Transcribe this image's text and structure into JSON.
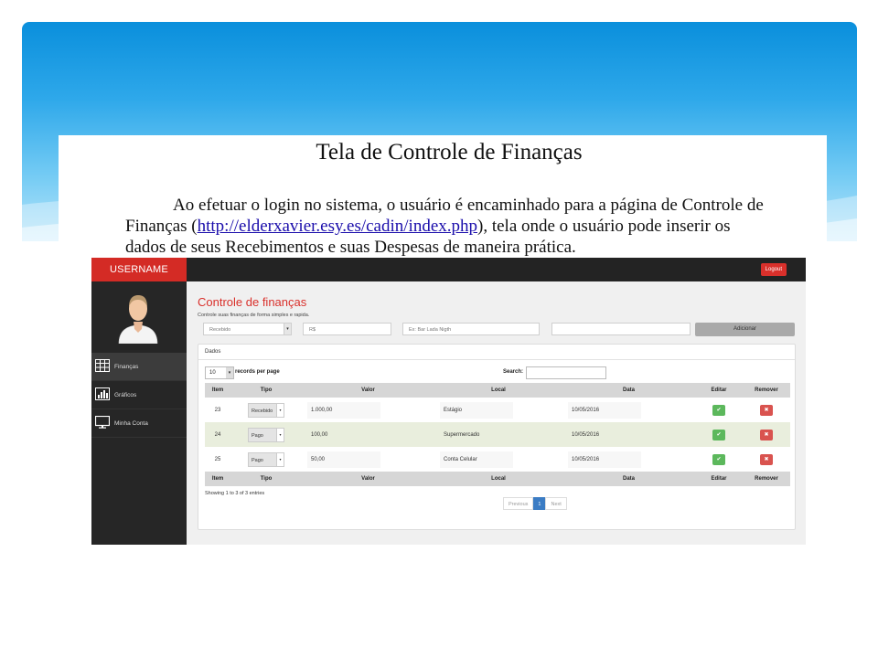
{
  "slide": {
    "title": "Tela de Controle de Finanças",
    "paragraph_before": "Ao efetuar o login no sistema, o usuário é encaminhado para a página de Controle de Finanças (",
    "link": "http://elderxavier.esy.es/cadin/index.php",
    "paragraph_after": "), tela onde o usuário pode inserir os dados de seus Recebimentos e suas Despesas de maneira prática."
  },
  "app": {
    "brand": "USERNAME",
    "logout": "Logout",
    "sidebar": [
      {
        "label": "Finanças",
        "icon": "table-icon",
        "active": true
      },
      {
        "label": "Gráficos",
        "icon": "bar-chart-icon",
        "active": false
      },
      {
        "label": "Minha Conta",
        "icon": "monitor-icon",
        "active": false
      }
    ],
    "page_title": "Controle de finanças",
    "page_subtitle": "Controle suas finanças de forma simples e rapida.",
    "form": {
      "tipo_value": "Recebido",
      "valor_placeholder": "R$",
      "local_placeholder": "Ex: Bar Lada Nigth",
      "data_value": "",
      "add_label": "Adicionar"
    },
    "panel_title": "Dados",
    "length_value": "10",
    "length_label": "records per page",
    "search_label": "Search:",
    "columns": [
      "Item",
      "Tipo",
      "Valor",
      "Local",
      "Data",
      "Editar",
      "Remover"
    ],
    "rows": [
      {
        "item": "23",
        "tipo": "Recebido",
        "valor": "1.000,00",
        "local": "Estágio",
        "data": "10/05/2016"
      },
      {
        "item": "24",
        "tipo": "Pago",
        "valor": "100,00",
        "local": "Supermercado",
        "data": "10/05/2016"
      },
      {
        "item": "25",
        "tipo": "Pago",
        "valor": "50,00",
        "local": "Conta Celular",
        "data": "10/05/2016"
      }
    ],
    "showing": "Showing 1 to 3 of 3 entries",
    "pager": {
      "previous": "Previous",
      "current": "1",
      "next": "Next"
    },
    "colors": {
      "brand": "#d42b25",
      "edit": "#5cb85c",
      "remove": "#d9534f",
      "accent_row": "#e9eedd"
    }
  }
}
